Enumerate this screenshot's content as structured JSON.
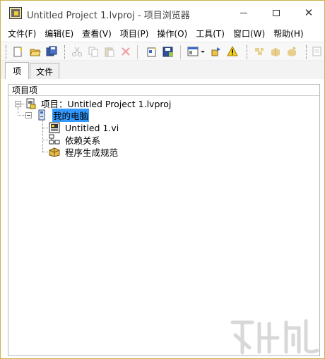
{
  "window": {
    "title": "Untitled Project 1.lvproj - 项目浏览器",
    "minimize_glyph": "",
    "maximize_glyph": "",
    "close_glyph": "✕"
  },
  "menu": {
    "items": [
      {
        "label": "文件(F)"
      },
      {
        "label": "编辑(E)"
      },
      {
        "label": "查看(V)"
      },
      {
        "label": "项目(P)"
      },
      {
        "label": "操作(O)"
      },
      {
        "label": "工具(T)"
      },
      {
        "label": "窗口(W)"
      },
      {
        "label": "帮助(H)"
      }
    ]
  },
  "toolbar": {
    "icons": [
      "new-icon",
      "open-icon",
      "save-all-icon",
      "cut-icon",
      "copy-icon",
      "paste-icon",
      "delete-icon",
      "add-file-icon",
      "save-project-icon",
      "view-dropdown-icon",
      "dependency-icon",
      "warning-icon",
      "build-icon",
      "build-spec-icon",
      "deploy-icon",
      "properties-icon"
    ]
  },
  "tabs": {
    "items": [
      {
        "label": "项"
      },
      {
        "label": "文件"
      }
    ]
  },
  "panel": {
    "header": "项目项",
    "tree": {
      "project": "项目：Untitled Project 1.lvproj",
      "computer": "我的电脑",
      "children": [
        {
          "label": "Untitled 1.vi",
          "icon": "vi-icon"
        },
        {
          "label": "依赖关系",
          "icon": "dependencies-icon"
        },
        {
          "label": "程序生成规范",
          "icon": "build-specifications-icon"
        }
      ]
    }
  },
  "colors": {
    "selection": "#3399ff",
    "window_border": "#c9b34c",
    "toolbar_bg": "#f8f8f8"
  }
}
